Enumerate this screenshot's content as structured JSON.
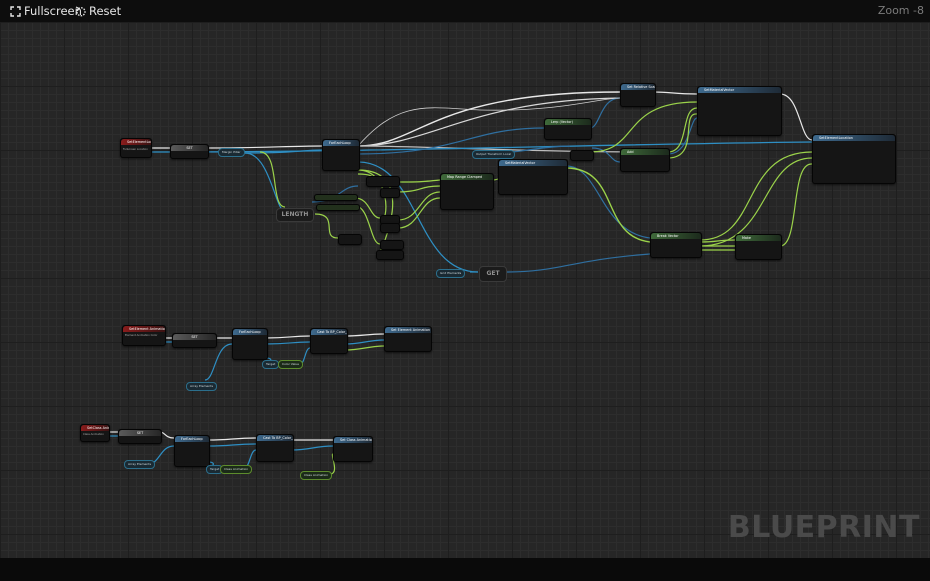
{
  "toolbar": {
    "fullscreen_label": "Fullscreen",
    "reset_label": "Reset",
    "zoom_label": "Zoom -8"
  },
  "watermark": "BLUEPRINT",
  "colors": {
    "exec_wire": "#e8e8e8",
    "float_wire": "#9bd34a",
    "object_wire": "#2e8fc4",
    "struct_wire": "#2f6fa0",
    "event_header": "#8a1c1c",
    "function_header": "#3e6a8e",
    "pure_header": "#3f6a3a"
  },
  "graph1": {
    "event_title": "SetElementLocation",
    "event_pin": "Fullscreen Location",
    "branch_title": "SET",
    "get_pill": "Margin Pillar",
    "fornode_title": "ForEachLoop",
    "length_label": "LENGTH",
    "get_label": "GET",
    "map_range_title": "Map Range Clamped",
    "lerp_title": "Lerp (Vector)",
    "set_relative_title": "Set Relative Scale3D",
    "set_material_title": "SetMaterialVector",
    "add_title": "Add",
    "set_loc_title": "SetElementLocation",
    "break_title": "Break Vector",
    "make_title": "Make",
    "output_pill": "Output Transform Local",
    "array_pill": "Grid Elements"
  },
  "graph2": {
    "event_title": "SetElement Animation Color",
    "event_pin": "Element Animation Color",
    "branch_title": "SET",
    "fornode_title": "ForEachLoop",
    "cast_title": "Cast To BP_Color_main",
    "set_title": "Set Element Animation Color",
    "array_pill": "Array Elements",
    "target_pill": "Target",
    "color_pill": "Color Value"
  },
  "graph3": {
    "event_title": "SetClass Animation",
    "event_pin": "Class Animation",
    "branch_title": "SET",
    "fornode_title": "ForEachLoop",
    "cast_title": "Cast To BP_Color_main",
    "set_title": "Set Class Animation",
    "array_pill": "Array Elements",
    "target_pill": "Target",
    "anim_pill": "Class Animation"
  }
}
